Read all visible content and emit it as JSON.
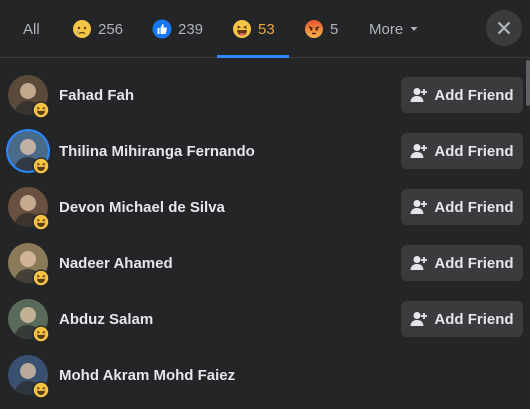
{
  "tabs": [
    {
      "label": "All"
    },
    {
      "icon": "crying-face-icon",
      "count": "256"
    },
    {
      "icon": "like-icon",
      "count": "239"
    },
    {
      "icon": "haha-icon",
      "count": "53"
    },
    {
      "icon": "angry-icon",
      "count": "5"
    }
  ],
  "more_label": "More",
  "add_friend_label": "Add Friend",
  "people": [
    {
      "name": "Fahad Fah",
      "avatar_bg": "#5a4a3a",
      "has_button": true
    },
    {
      "name": "Thilina Mihiranga Fernando",
      "avatar_bg": "#4a6a8a",
      "has_button": true
    },
    {
      "name": "Devon Michael de Silva",
      "avatar_bg": "#6a5040",
      "has_button": true
    },
    {
      "name": "Nadeer Ahamed",
      "avatar_bg": "#8a7a5a",
      "has_button": true
    },
    {
      "name": "Abduz Salam",
      "avatar_bg": "#5a6a5a",
      "has_button": true
    },
    {
      "name": "Mohd Akram Mohd Faiez",
      "avatar_bg": "#3a5070",
      "has_button": false
    }
  ],
  "colors": {
    "accent": "#2d88ff",
    "active_tab": "#e8a64a",
    "background": "#242526"
  }
}
